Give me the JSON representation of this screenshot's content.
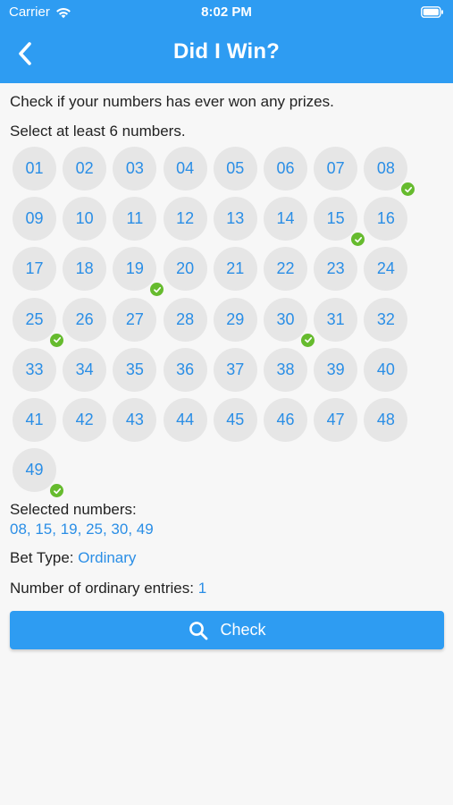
{
  "status_bar": {
    "carrier": "Carrier",
    "time": "8:02 PM",
    "icons": [
      "wifi-icon",
      "battery-icon"
    ]
  },
  "header": {
    "title": "Did I Win?",
    "back_icon": "chevron-left-icon"
  },
  "instructions": {
    "intro": "Check if your numbers has ever won any prizes.",
    "select_hint": "Select at least 6 numbers."
  },
  "numbers": [
    "01",
    "02",
    "03",
    "04",
    "05",
    "06",
    "07",
    "08",
    "09",
    "10",
    "11",
    "12",
    "13",
    "14",
    "15",
    "16",
    "17",
    "18",
    "19",
    "20",
    "21",
    "22",
    "23",
    "24",
    "25",
    "26",
    "27",
    "28",
    "29",
    "30",
    "31",
    "32",
    "33",
    "34",
    "35",
    "36",
    "37",
    "38",
    "39",
    "40",
    "41",
    "42",
    "43",
    "44",
    "45",
    "46",
    "47",
    "48",
    "49"
  ],
  "selected_numbers": [
    "08",
    "15",
    "19",
    "25",
    "30",
    "49"
  ],
  "summary": {
    "selected_label": "Selected numbers:",
    "selected_values": "08, 15, 19, 25, 30, 49",
    "bet_type_label": "Bet Type: ",
    "bet_type_value": "Ordinary",
    "entries_label": "Number of ordinary entries: ",
    "entries_value": "1"
  },
  "actions": {
    "check_label": "Check",
    "check_icon": "search-icon"
  },
  "colors": {
    "primary": "#2e9cf2",
    "number_text": "#2a8ee6",
    "ball_bg": "#e6e6e6",
    "check_badge": "#66bb2e"
  }
}
